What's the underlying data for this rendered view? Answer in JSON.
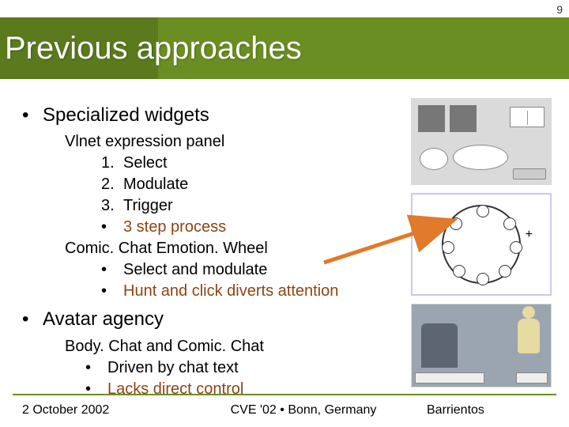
{
  "page_number": "9",
  "title": "Previous approaches",
  "section1": {
    "heading": "Specialized widgets",
    "item1_title": "Vlnet expression panel",
    "steps": [
      "Select",
      "Modulate",
      "Trigger"
    ],
    "note": "3 step process",
    "item2_title": "Comic. Chat Emotion. Wheel",
    "item2_points": [
      "Select and modulate",
      "Hunt and click diverts attention"
    ]
  },
  "section2": {
    "heading": "Avatar agency",
    "item_title": "Body. Chat and Comic. Chat",
    "points": [
      "Driven by chat text",
      "Lacks direct control"
    ]
  },
  "footer": {
    "date": "2 October 2002",
    "venue": "CVE '02  •  Bonn, Germany",
    "author": "Barrientos"
  }
}
